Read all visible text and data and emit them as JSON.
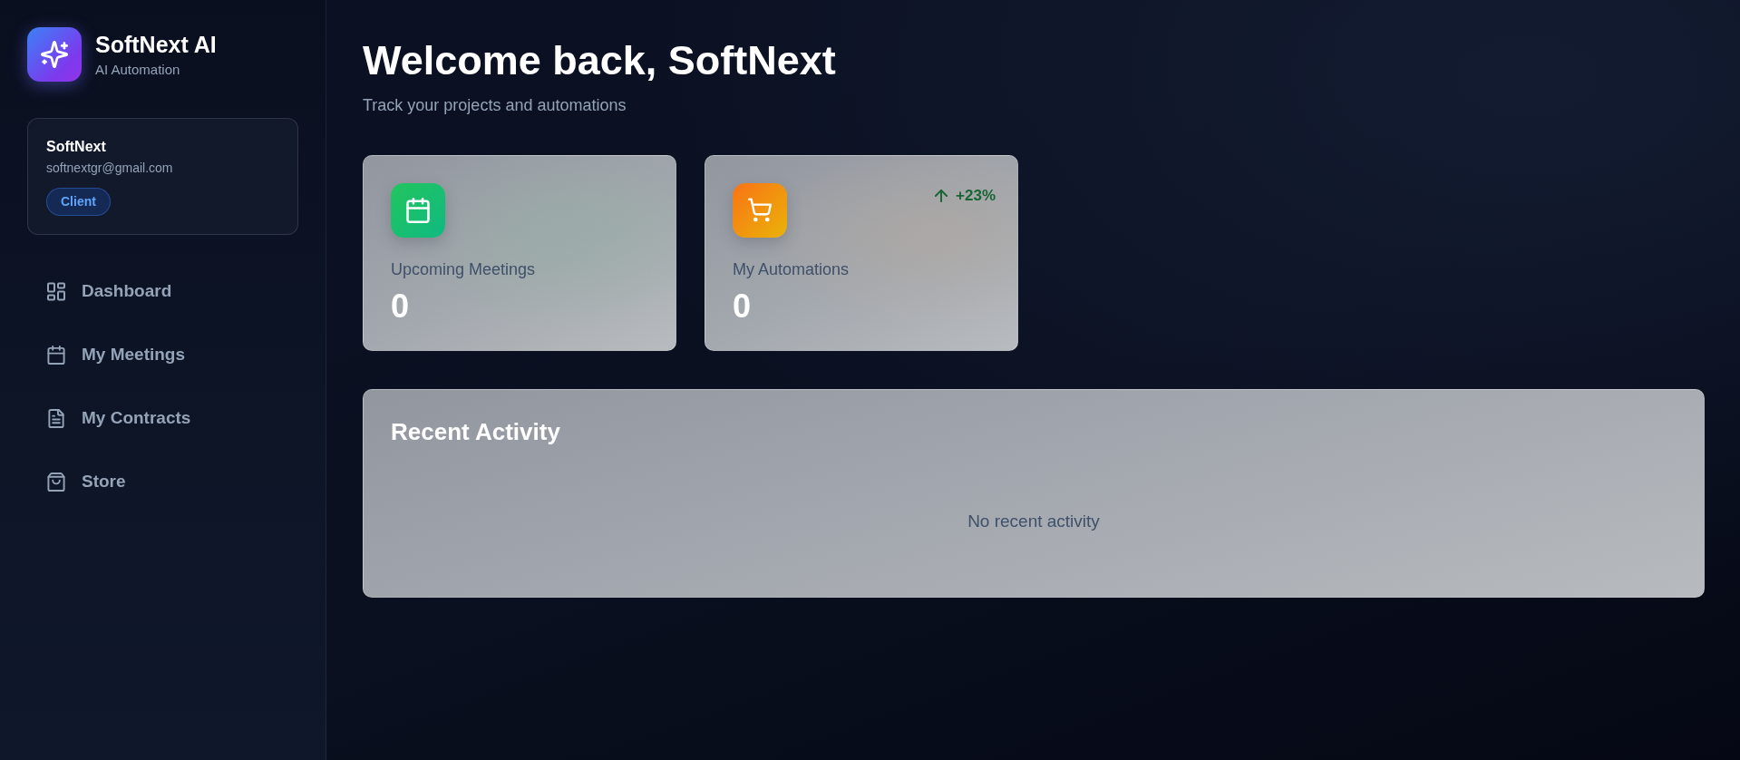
{
  "sidebar": {
    "brand": {
      "title": "SoftNext AI",
      "subtitle": "AI Automation"
    },
    "user": {
      "name": "SoftNext",
      "email": "softnextgr@gmail.com",
      "role": "Client"
    },
    "nav": [
      {
        "label": "Dashboard",
        "selected": false
      },
      {
        "label": "My Meetings",
        "selected": false
      },
      {
        "label": "My Contracts",
        "selected": false
      },
      {
        "label": "Store",
        "selected": false
      }
    ]
  },
  "header": {
    "title": "Welcome back, SoftNext",
    "subtitle": "Track your projects and automations"
  },
  "stats": [
    {
      "label": "Upcoming Meetings",
      "value": "0"
    },
    {
      "label": "My Automations",
      "value": "0",
      "trend": "+23%"
    }
  ],
  "activity": {
    "title": "Recent Activity",
    "empty_text": "No recent activity"
  }
}
